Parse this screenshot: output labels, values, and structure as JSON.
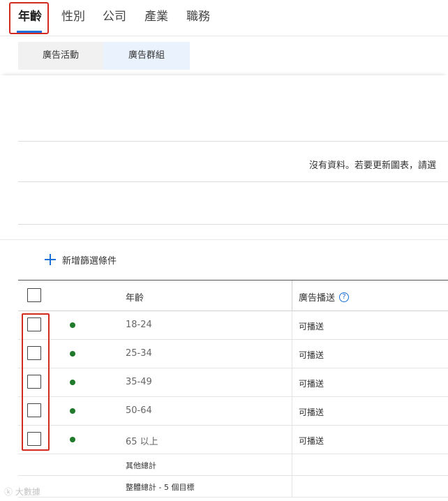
{
  "top_tabs": [
    {
      "label": "年齡",
      "active": true
    },
    {
      "label": "性別",
      "active": false
    },
    {
      "label": "公司",
      "active": false
    },
    {
      "label": "產業",
      "active": false
    },
    {
      "label": "職務",
      "active": false
    }
  ],
  "sub_toggle": {
    "campaign_label": "廣告活動",
    "group_label": "廣告群組",
    "selected": "廣告群組"
  },
  "chart": {
    "empty_message": "沒有資料。若要更新圖表，請選"
  },
  "filter": {
    "add_label": "新增篩選條件"
  },
  "table": {
    "headers": {
      "age": "年齡",
      "delivery": "廣告播送"
    },
    "rows": [
      {
        "age": "18-24",
        "status": "可播送"
      },
      {
        "age": "25-34",
        "status": "可播送"
      },
      {
        "age": "35-49",
        "status": "可播送"
      },
      {
        "age": "50-64",
        "status": "可播送"
      },
      {
        "age": "65 以上",
        "status": "可播送"
      }
    ],
    "summary": {
      "other_total": "其他總計",
      "overall_total": "整體總計 - 5 個目標"
    }
  },
  "colors": {
    "accent": "#1a6fd8",
    "highlight_box": "#d42b20",
    "status_dot": "#1f7a2c"
  },
  "watermark": "ⓚ 大數據"
}
